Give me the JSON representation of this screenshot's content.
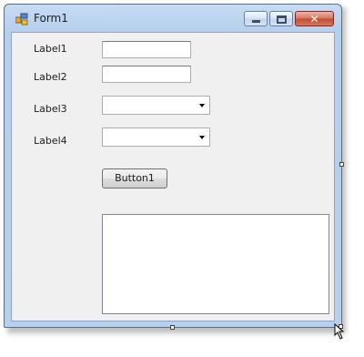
{
  "window": {
    "title": "Form1",
    "icon": "form-icon",
    "caption_buttons": [
      "minimize-icon",
      "maximize-icon",
      "close-icon"
    ]
  },
  "form": {
    "labels": [
      "Label1",
      "Label2",
      "Label3",
      "Label4"
    ],
    "textbox1_value": "",
    "textbox2_value": "",
    "combo1_value": "",
    "combo2_value": "",
    "button_label": "Button1",
    "multiline_value": ""
  },
  "colors": {
    "titlebar": "#c6dcf3",
    "client": "#f0f0f0",
    "close_button": "#c24a31"
  }
}
